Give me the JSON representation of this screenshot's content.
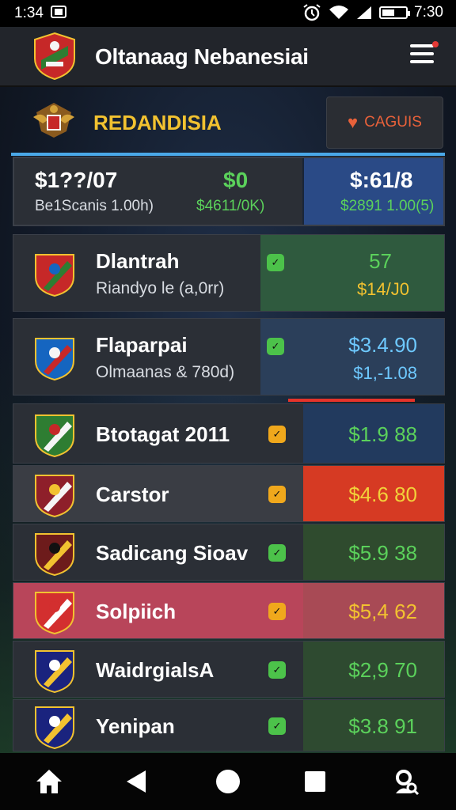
{
  "status": {
    "time": "1:34",
    "clock_right": "7:30",
    "battery_level": 0.55,
    "icons": [
      "alarm-icon",
      "wifi-icon",
      "signal-icon",
      "battery-icon"
    ]
  },
  "header": {
    "title": "Oltanaag Nebanesiai",
    "logo_icon": "club-crest-icon",
    "menu_icon": "hamburger-menu-icon"
  },
  "section": {
    "title": "REDANDISIA",
    "cancel_label": "CAGUIS",
    "title_color": "#f2c230",
    "accent_color": "#e8613a"
  },
  "summary": {
    "left_value": "$1??/07",
    "left_caption": "Be1Scanis 1.00h)",
    "mid_value": "$0",
    "mid_caption": "$4611/0K)",
    "right_value": "$:61/8",
    "right_caption": "$2891 1.00(5)"
  },
  "rows": [
    {
      "name": "Dlantrah",
      "sub": "Riandyo le (a,0rr)",
      "value": "57",
      "value2": "$14/J0",
      "badge": "green",
      "panel": "#2f5a3e",
      "bg": "#2b2f36",
      "crest": [
        "#c62828",
        "#2e7d32",
        "#1565c0"
      ]
    },
    {
      "name": "Flaparpai",
      "sub": "Olmaanas & 780d)",
      "value": "$3.4.90",
      "value2": "$1,-1.08",
      "badge": "green",
      "panel": "#2b3f5a",
      "bg": "#2b2f36",
      "crest": [
        "#1565c0",
        "#c62828",
        "#f5f5f5"
      ]
    },
    {
      "name": "Btotagat 2011",
      "sub": "",
      "value": "$1.9 88",
      "value2": "",
      "badge": "amber",
      "panel": "#223a5e",
      "bg": "#2b2f36",
      "crest": [
        "#2e7d32",
        "#f5f5f5",
        "#c62828"
      ]
    },
    {
      "name": "Carstor",
      "sub": "",
      "value": "$4.6 80",
      "value2": "",
      "badge": "amber",
      "panel": "#d63a23",
      "bg": "#3a3d44",
      "crest": [
        "#8e1f2a",
        "#f5f5f5",
        "#f2c230"
      ]
    },
    {
      "name": "Sadicang Sioav",
      "sub": "",
      "value": "$5.9 38",
      "value2": "",
      "badge": "green",
      "panel": "#2f4b2e",
      "bg": "#2b2f36",
      "crest": [
        "#6d1b1b",
        "#f2c230",
        "#111111"
      ]
    },
    {
      "name": "Solpiich",
      "sub": "",
      "value": "$5,4 62",
      "value2": "",
      "badge": "amber",
      "panel": "#a84a55",
      "bg": "#b8455a",
      "crest": [
        "#d32f2f",
        "#ffffff",
        "#d32f2f"
      ]
    },
    {
      "name": "WaidrgialsA",
      "sub": "",
      "value": "$2,9 70",
      "value2": "",
      "badge": "green",
      "panel": "#2e4a30",
      "bg": "#2b2f36",
      "crest": [
        "#1a237e",
        "#f2c230",
        "#ffffff"
      ]
    },
    {
      "name": "Yenipan",
      "sub": "",
      "value": "$3.8 91",
      "value2": "",
      "badge": "green",
      "panel": "#2e4a30",
      "bg": "#2b2f36",
      "crest": [
        "#1a237e",
        "#f2c230",
        "#ffffff"
      ]
    }
  ],
  "nav": [
    "home-icon",
    "back-icon",
    "home-circle-icon",
    "recents-icon",
    "search-account-icon"
  ]
}
